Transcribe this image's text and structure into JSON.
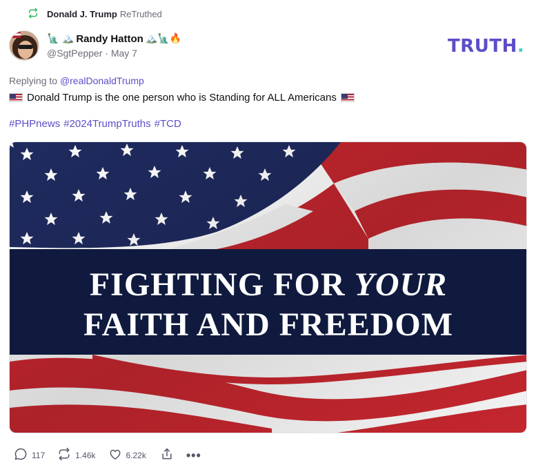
{
  "retruth": {
    "name": "Donald J. Trump",
    "suffix": "ReTruthed"
  },
  "author": {
    "emoji_before": "🗽 🏔️",
    "name": "Randy Hatton",
    "emoji_after": "🏔️🗽🔥",
    "handle": "@SgtPepper",
    "separator": "·",
    "date": "May 7"
  },
  "logo": {
    "text": "TRUTH",
    "dot": "."
  },
  "reply": {
    "prefix": "Replying to",
    "mention": "@realDonaldTrump"
  },
  "post": {
    "text": "Donald Trump is the one person who is Standing for ALL Americans",
    "hashtags": [
      "#PHPnews",
      "#2024TrumpTruths",
      "#TCD"
    ]
  },
  "media": {
    "line1_a": "FIGHTING FOR ",
    "line1_b": "YOUR",
    "line2": "FAITH AND FREEDOM"
  },
  "actions": {
    "replies": "117",
    "retruths": "1.46k",
    "likes": "6.22k",
    "more": "•••"
  },
  "colors": {
    "accent": "#5b4ec7",
    "retruth_green": "#2fb55e",
    "banner_navy": "#101a3e",
    "flag_red": "#c4262e",
    "flag_blue": "#1f2a5e"
  }
}
